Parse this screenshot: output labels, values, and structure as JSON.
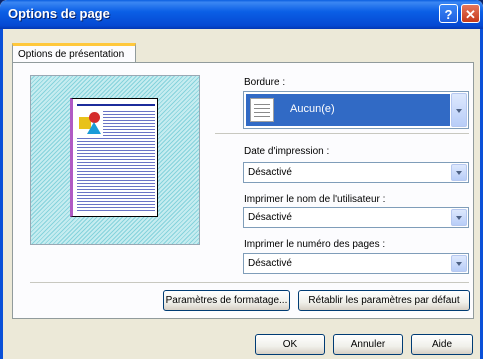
{
  "window": {
    "title": "Options de page"
  },
  "tabs": [
    {
      "label": "Options de présentation"
    }
  ],
  "border": {
    "label": "Bordure :",
    "value": "Aucun(e)"
  },
  "print_date": {
    "label": "Date d'impression :",
    "value": "Désactivé"
  },
  "print_user": {
    "label": "Imprimer le nom de l'utilisateur :",
    "value": "Désactivé"
  },
  "print_pages": {
    "label": "Imprimer le numéro des pages :",
    "value": "Désactivé"
  },
  "buttons": {
    "formatting": "Paramètres de formatage...",
    "restore": "Rétablir les paramètres par défaut",
    "ok": "OK",
    "cancel": "Annuler",
    "help": "Aide"
  },
  "title_buttons": {
    "help": "?",
    "close": "✕"
  },
  "icons": [
    "help-icon",
    "close-icon",
    "chevron-down-icon",
    "border-none-icon"
  ],
  "colors": {
    "titlebar": "#0b5fe6",
    "selection": "#316ac5",
    "tab_accent": "#ffc83c"
  }
}
